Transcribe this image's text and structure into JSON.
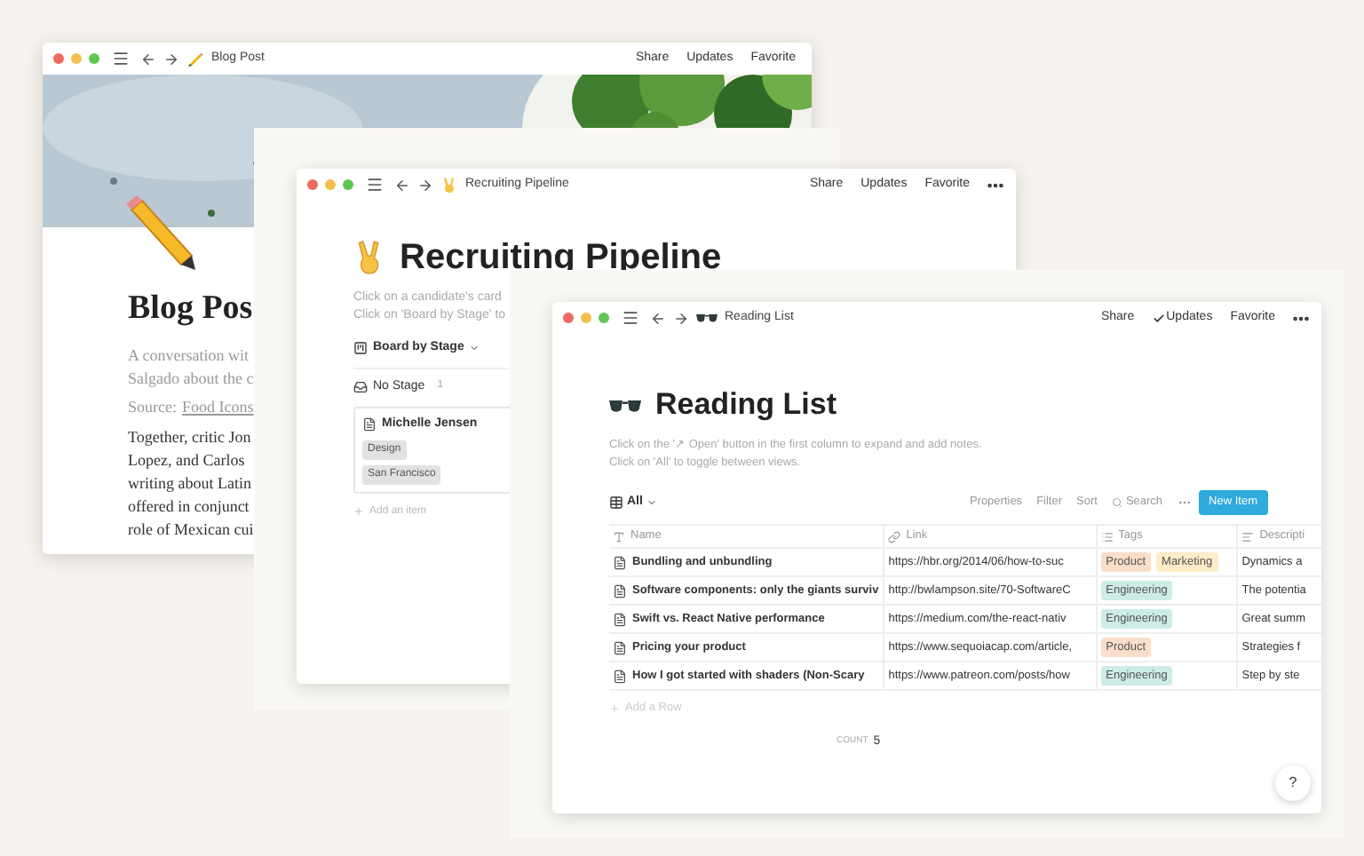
{
  "windows": [
    {
      "kind": "blog",
      "title": "Blog Post",
      "actions": [
        {
          "label": "Share",
          "checked": false
        },
        {
          "label": "Updates",
          "checked": false
        },
        {
          "label": "Favorite",
          "checked": false
        }
      ],
      "more": false,
      "heading": "Blog Pos",
      "intro": [
        "A conversation wit",
        "Salgado about the c"
      ],
      "source": {
        "label": "Source:",
        "link": "Food Icons"
      },
      "body": [
        "Together, critic Jon",
        "Lopez, and Carlos",
        "writing about Latin",
        "offered in conjunct",
        "role of Mexican cui"
      ]
    },
    {
      "kind": "board",
      "title": "Recruiting Pipeline",
      "actions": [
        {
          "label": "Share",
          "checked": false
        },
        {
          "label": "Updates",
          "checked": false
        },
        {
          "label": "Favorite",
          "checked": false
        }
      ],
      "more": true,
      "heading": "Recruiting Pipeline",
      "description": [
        "Click on a candidate's card",
        "Click on 'Board by Stage' to"
      ],
      "view": "Board by Stage",
      "group": {
        "name": "No Stage",
        "count": "1"
      },
      "cards": [
        {
          "title": "Michelle Jensen",
          "tags": [
            "Design",
            "San Francisco"
          ]
        }
      ],
      "add_label": "Add an item"
    },
    {
      "kind": "table",
      "title": "Reading List",
      "actions": [
        {
          "label": "Share",
          "checked": false
        },
        {
          "label": "Updates",
          "checked": true
        },
        {
          "label": "Favorite",
          "checked": false
        }
      ],
      "more": true,
      "heading": "Reading List",
      "description": [
        "Click on the '↗ Open' button in the first column to expand and add notes.",
        "Click on 'All' to toggle between views."
      ],
      "view": "All",
      "tools": [
        "Properties",
        "Filter",
        "Sort"
      ],
      "search": "Search",
      "new_button": "New Item",
      "table": {
        "columns": [
          {
            "label": "Name",
            "kind": "title"
          },
          {
            "label": "Link",
            "kind": "url"
          },
          {
            "label": "Tags",
            "kind": "tags"
          },
          {
            "label": "Descripti",
            "kind": "text"
          }
        ],
        "rows": [
          {
            "name": "Bundling and unbundling",
            "link": "https://hbr.org/2014/06/how-to-suc",
            "tags": [
              {
                "label": "Product",
                "color": "#fadec9"
              },
              {
                "label": "Marketing",
                "color": "#fdecc8"
              }
            ],
            "description": "Dynamics a"
          },
          {
            "name": "Software components: only the giants surviv",
            "link": "http://bwlampson.site/70-SoftwareC",
            "tags": [
              {
                "label": "Engineering",
                "color": "#cdece6"
              }
            ],
            "description": "The potentia"
          },
          {
            "name": "Swift vs. React Native performance",
            "link": "https://medium.com/the-react-nativ",
            "tags": [
              {
                "label": "Engineering",
                "color": "#cdece6"
              }
            ],
            "description": "Great summ"
          },
          {
            "name": "Pricing your product",
            "link": "https://www.sequoiacap.com/article,",
            "tags": [
              {
                "label": "Product",
                "color": "#fadec9"
              }
            ],
            "description": "Strategies f"
          },
          {
            "name": "How I got started with shaders (Non-Scary",
            "link": "https://www.patreon.com/posts/how",
            "tags": [
              {
                "label": "Engineering",
                "color": "#cdece6"
              }
            ],
            "description": "Step by ste"
          }
        ]
      },
      "add_label": "Add a Row",
      "count": {
        "label": "COUNT",
        "value": "5"
      },
      "help": "?"
    }
  ]
}
